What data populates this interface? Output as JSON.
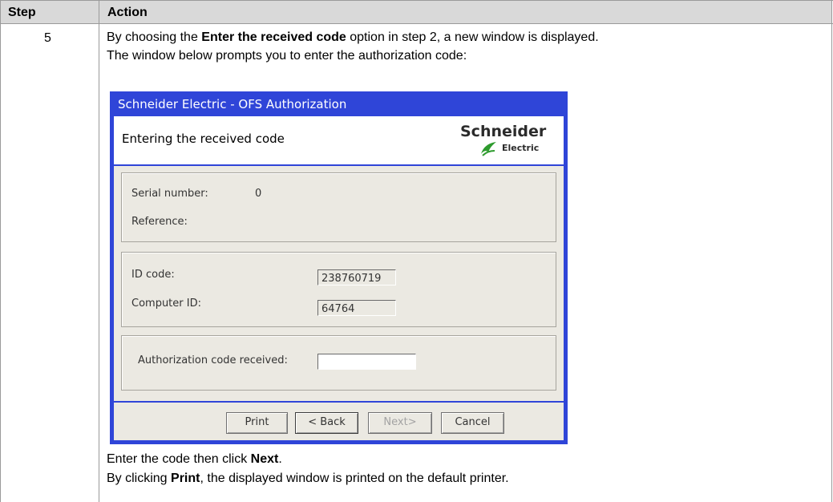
{
  "table": {
    "header_step": "Step",
    "header_action": "Action",
    "step_number": "5"
  },
  "text": {
    "p1_before": "By choosing the ",
    "p1_bold": "Enter the received code",
    "p1_after": " option in step 2, a new window is displayed.",
    "p2": "The window below prompts you to enter the authorization code:",
    "p3_before": "Enter the code then click ",
    "p3_bold": "Next",
    "p3_after": ".",
    "p4_before": "By clicking ",
    "p4_bold": "Print",
    "p4_after": ", the displayed window is printed on the default printer."
  },
  "dialog": {
    "title": "Schneider Electric - OFS Authorization",
    "banner_title": "Entering the received code",
    "logo_word": "Schneider",
    "logo_sub": "Electric",
    "serial_label": "Serial number:",
    "serial_value": "0",
    "reference_label": "Reference:",
    "id_code_label": "ID code:",
    "id_code_value": "238760719",
    "computer_id_label": "Computer ID:",
    "computer_id_value": "64764",
    "auth_label": "Authorization code received:",
    "auth_value": "",
    "buttons": {
      "print": "Print",
      "back": "< Back",
      "next": "Next>",
      "cancel": "Cancel"
    },
    "colors": {
      "title_bar": "#2f45d8",
      "body": "#ebe9e2",
      "logo_green": "#2e9b2e"
    }
  }
}
